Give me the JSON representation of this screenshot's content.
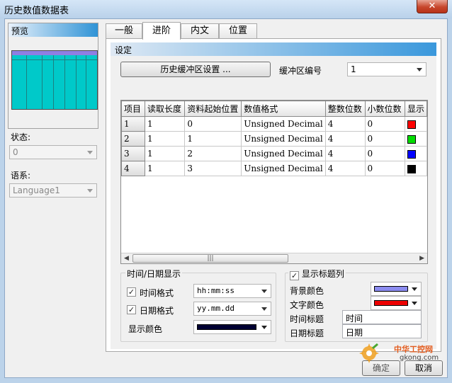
{
  "window": {
    "title": "历史数值数据表",
    "close_glyph": "✕"
  },
  "left": {
    "preview_label": "预览",
    "status_label": "状态:",
    "status_value": "0",
    "language_label": "语系:",
    "language_value": "Language1"
  },
  "tabs": [
    {
      "label": "一般",
      "active": false
    },
    {
      "label": "进阶",
      "active": true
    },
    {
      "label": "内文",
      "active": false
    },
    {
      "label": "位置",
      "active": false
    }
  ],
  "settings": {
    "header": "设定",
    "history_buffer_button": "历史缓冲区设置 ...",
    "buffer_number_label": "缓冲区编号",
    "buffer_number_value": "1"
  },
  "table": {
    "headers": [
      "项目",
      "读取长度",
      "资料起始位置",
      "数值格式",
      "整数位数",
      "小数位数",
      "显示"
    ],
    "rows": [
      {
        "item": "1",
        "length": "1",
        "start": "0",
        "format": "Unsigned Decimal",
        "int_digits": "4",
        "dec_digits": "0",
        "color": "#ff0000"
      },
      {
        "item": "2",
        "length": "1",
        "start": "1",
        "format": "Unsigned Decimal",
        "int_digits": "4",
        "dec_digits": "0",
        "color": "#00dd00"
      },
      {
        "item": "3",
        "length": "1",
        "start": "2",
        "format": "Unsigned Decimal",
        "int_digits": "4",
        "dec_digits": "0",
        "color": "#0000ff"
      },
      {
        "item": "4",
        "length": "1",
        "start": "3",
        "format": "Unsigned Decimal",
        "int_digits": "4",
        "dec_digits": "0",
        "color": "#000000"
      }
    ],
    "scroll_left": "◀",
    "scroll_right": "▶",
    "scroll_grip": "|||"
  },
  "datetime": {
    "group_title": "时间/日期显示",
    "time_format_label": "时间格式",
    "time_format_value": "hh:mm:ss",
    "time_format_checked": true,
    "date_format_label": "日期格式",
    "date_format_value": "yy.mm.dd",
    "date_format_checked": true,
    "display_color_label": "显示颜色",
    "display_color": "#000033"
  },
  "title_column": {
    "checkbox_label": "显示标题列",
    "checked": true,
    "bg_color_label": "背景颜色",
    "bg_color": "#8c8cf0",
    "text_color_label": "文字颜色",
    "text_color": "#ee0000",
    "time_title_label": "时间标题",
    "time_title_value": "时间",
    "date_title_label": "日期标题",
    "date_title_value": "日期"
  },
  "buttons": {
    "ok": "确定",
    "cancel": "取消"
  },
  "watermark": {
    "line1": "中华工控网",
    "line2": "gkong.com"
  }
}
